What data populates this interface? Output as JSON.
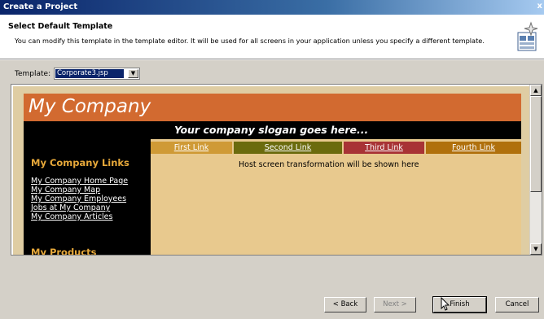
{
  "window": {
    "title": "Create a Project",
    "close_glyph": "x"
  },
  "header": {
    "title": "Select Default Template",
    "description": "You can modify this template in the template editor.  It will be used for all screens in your application unless you specify a different template.",
    "icon": "wizard-template-icon"
  },
  "template": {
    "label": "Template:",
    "selected": "Corporate3.jsp"
  },
  "preview": {
    "company_name": "My Company",
    "slogan": "Your company slogan goes here...",
    "nav_links": [
      {
        "label": "First Link",
        "color": "#cf9a36"
      },
      {
        "label": "Second Link",
        "color": "#6b6b0d"
      },
      {
        "label": "Third Link",
        "color": "#a83335"
      },
      {
        "label": "Fourth Link",
        "color": "#b0700c"
      }
    ],
    "sidebar_heading": "My Company Links",
    "sidebar_links": [
      "My Company Home Page",
      "My Company Map",
      "My Company Employees",
      "Jobs at My Company",
      "My Company Articles"
    ],
    "sidebar_heading_2": "My Products",
    "content_text": "Host screen transformation will be shown here"
  },
  "buttons": {
    "back": "< Back",
    "next": "Next >",
    "finish": "Finish",
    "cancel": "Cancel"
  },
  "colors": {
    "banner": "#d26a30",
    "content_bg": "#e8c98e",
    "sidebar_heading": "#e8a93a"
  }
}
